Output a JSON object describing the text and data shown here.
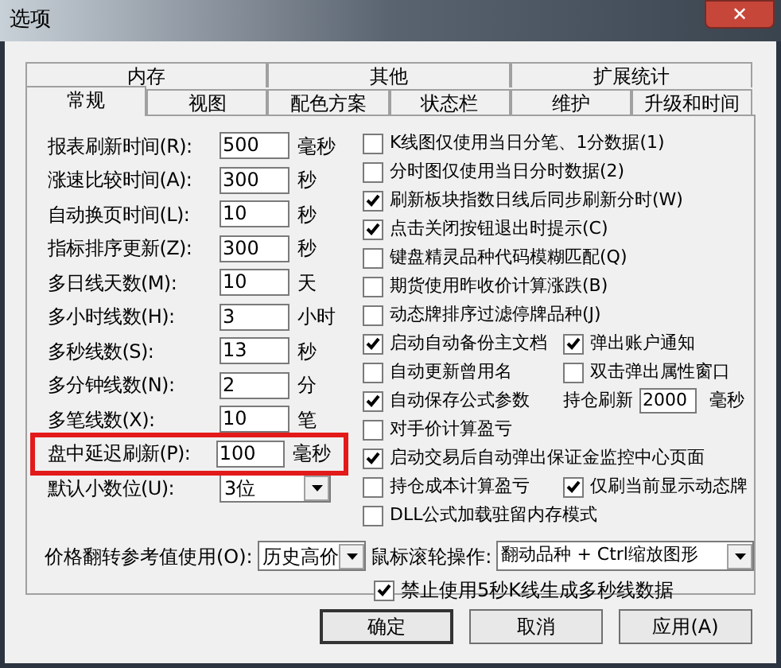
{
  "window": {
    "title": "选项",
    "close": "✕"
  },
  "tabs": [
    [
      {
        "label": "内存",
        "selected": false
      },
      {
        "label": "其他",
        "selected": false
      },
      {
        "label": "扩展统计",
        "selected": false
      }
    ],
    [
      {
        "label": "常规",
        "selected": true
      },
      {
        "label": "视图",
        "selected": false
      },
      {
        "label": "配色方案",
        "selected": false
      },
      {
        "label": "状态栏",
        "selected": false
      },
      {
        "label": "维护",
        "selected": false
      },
      {
        "label": "升级和时间",
        "selected": false
      }
    ]
  ],
  "fields": [
    {
      "kind": "input",
      "label": "报表刷新时间(R):",
      "value": "500",
      "unit": "毫秒",
      "highlighted": false
    },
    {
      "kind": "input",
      "label": "涨速比较时间(A):",
      "value": "300",
      "unit": "秒",
      "highlighted": false
    },
    {
      "kind": "input",
      "label": "自动换页时间(L):",
      "value": "10",
      "unit": "秒",
      "highlighted": false
    },
    {
      "kind": "input",
      "label": "指标排序更新(Z):",
      "value": "300",
      "unit": "秒",
      "highlighted": false
    },
    {
      "kind": "input",
      "label": "多日线天数(M):",
      "value": "10",
      "unit": "天",
      "highlighted": false
    },
    {
      "kind": "input",
      "label": "多小时线数(H):",
      "value": "3",
      "unit": "小时",
      "highlighted": false
    },
    {
      "kind": "input",
      "label": "多秒线数(S):",
      "value": "13",
      "unit": "秒",
      "highlighted": false
    },
    {
      "kind": "input",
      "label": "多分钟线数(N):",
      "value": "2",
      "unit": "分",
      "highlighted": false
    },
    {
      "kind": "input",
      "label": "多笔线数(X):",
      "value": "10",
      "unit": "笔",
      "highlighted": false
    },
    {
      "kind": "input",
      "label": "盘中延迟刷新(P):",
      "value": "100",
      "unit": "毫秒",
      "highlighted": true
    },
    {
      "kind": "select",
      "label": "默认小数位(U):",
      "value": "3位",
      "highlighted": false
    }
  ],
  "options": [
    [
      {
        "kind": "checkbox",
        "label": "K线图仅使用当日分笔、1分数据(1)",
        "checked": false
      }
    ],
    [
      {
        "kind": "checkbox",
        "label": "分时图仅使用当日分时数据(2)",
        "checked": false
      }
    ],
    [
      {
        "kind": "checkbox",
        "label": "刷新板块指数日线后同步刷新分时(W)",
        "checked": true
      }
    ],
    [
      {
        "kind": "checkbox",
        "label": "点击关闭按钮退出时提示(C)",
        "checked": true
      }
    ],
    [
      {
        "kind": "checkbox",
        "label": "键盘精灵品种代码模糊匹配(Q)",
        "checked": false
      }
    ],
    [
      {
        "kind": "checkbox",
        "label": "期货使用昨收价计算涨跌(B)",
        "checked": false
      }
    ],
    [
      {
        "kind": "checkbox",
        "label": "动态牌排序过滤停牌品种(J)",
        "checked": false
      }
    ],
    [
      {
        "kind": "checkbox",
        "label": "启动自动备份主文档",
        "checked": true
      },
      {
        "kind": "checkbox",
        "label": "弹出账户通知",
        "checked": true
      }
    ],
    [
      {
        "kind": "checkbox",
        "label": "自动更新曾用名",
        "checked": false
      },
      {
        "kind": "checkbox",
        "label": "双击弹出属性窗口",
        "checked": false
      }
    ],
    [
      {
        "kind": "checkbox",
        "label": "自动保存公式参数",
        "checked": true
      },
      {
        "kind": "field",
        "label": "持仓刷新",
        "value": "2000",
        "unit": "毫秒"
      }
    ],
    [
      {
        "kind": "checkbox",
        "label": "对手价计算盈亏",
        "checked": false
      }
    ],
    [
      {
        "kind": "checkbox",
        "label": "启动交易后自动弹出保证金监控中心页面",
        "checked": true
      }
    ],
    [
      {
        "kind": "checkbox",
        "label": "持仓成本计算盈亏",
        "checked": false
      },
      {
        "kind": "checkbox",
        "label": "仅刷当前显示动态牌",
        "checked": true
      }
    ],
    [
      {
        "kind": "checkbox",
        "label": "DLL公式加载驻留内存模式",
        "checked": false
      }
    ]
  ],
  "price_flip": {
    "label": "价格翻转参考值使用(O):",
    "value": "历史高价"
  },
  "wheel": {
    "label": "鼠标滚轮操作:",
    "value": "翻动品种 + Ctrl缩放图形"
  },
  "forbid": {
    "label": "禁止使用5秒K线生成多秒线数据",
    "checked": true
  },
  "buttons": [
    "确定",
    "取消",
    "应用(A)"
  ]
}
